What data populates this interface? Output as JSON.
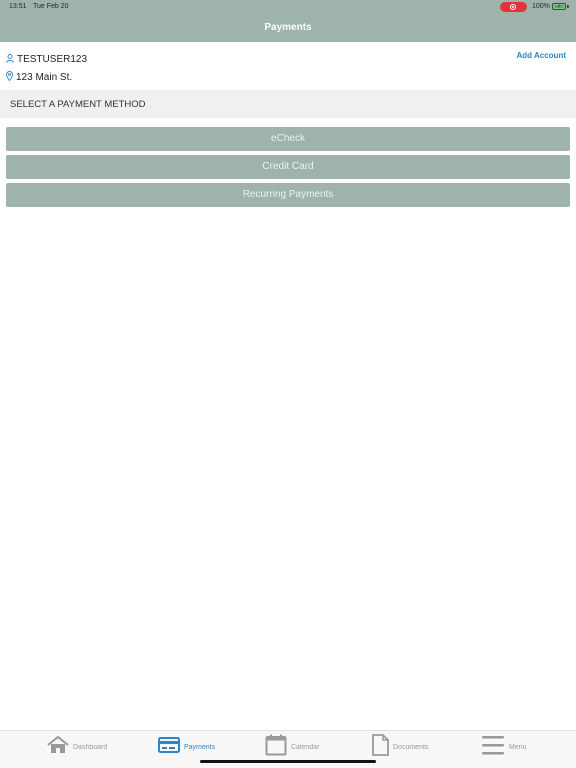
{
  "status_bar": {
    "time": "13:51",
    "date": "Tue Feb 20",
    "battery_percent": "100%",
    "icons": [
      "screen-recording-icon",
      "battery-charging-icon"
    ]
  },
  "navbar": {
    "title": "Payments"
  },
  "account": {
    "username": "TESTUSER123",
    "address": "123 Main St.",
    "add_account_label": "Add Account",
    "icons": [
      "user-icon",
      "location-pin-icon"
    ]
  },
  "section": {
    "title": "SELECT A PAYMENT METHOD"
  },
  "payment_methods": [
    {
      "label": "eCheck"
    },
    {
      "label": "Credit Card"
    },
    {
      "label": "Recurring Payments"
    }
  ],
  "tabs": [
    {
      "label": "Dashboard",
      "icon": "home-icon",
      "active": false
    },
    {
      "label": "Payments",
      "icon": "payment-card-icon",
      "active": true
    },
    {
      "label": "Calendar",
      "icon": "calendar-icon",
      "active": false
    },
    {
      "label": "Documents",
      "icon": "document-icon",
      "active": false
    },
    {
      "label": "Menu",
      "icon": "menu-icon",
      "active": false
    }
  ],
  "colors": {
    "header_bg": "#9db3ac",
    "button_bg": "#9db3ac",
    "accent": "#2e86c1",
    "section_bg": "#f0f0f0",
    "tab_inactive": "#9a9a9a"
  }
}
